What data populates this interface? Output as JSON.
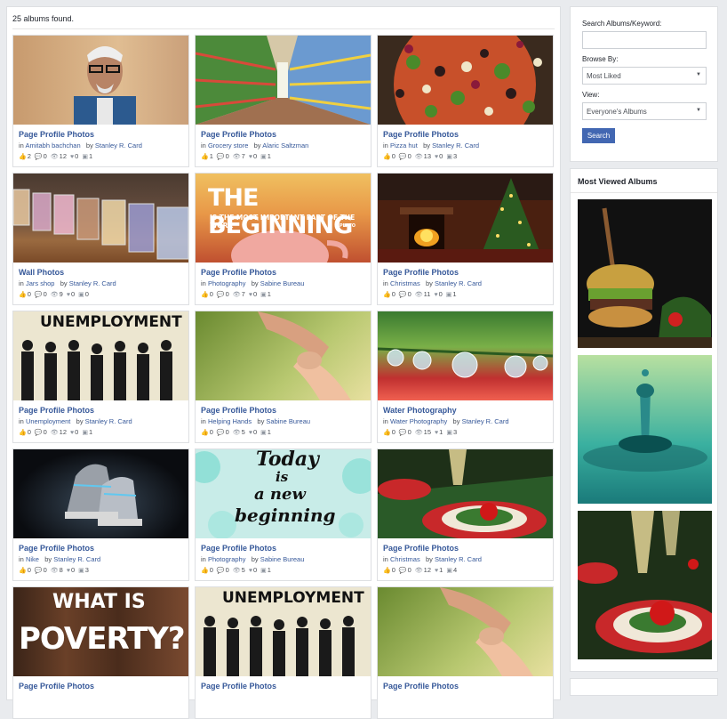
{
  "results": {
    "found_text": "25 albums found."
  },
  "albums": [
    {
      "title": "Page Profile Photos",
      "in_label": "in",
      "category": "Amitabh bachchan",
      "by_label": "by",
      "author": "Stanley R. Card",
      "likes": "2",
      "comments": "0",
      "views": "12",
      "favorites": "0",
      "photos": "1"
    },
    {
      "title": "Page Profile Photos",
      "in_label": "in",
      "category": "Grocery store",
      "by_label": "by",
      "author": "Alaric Saltzman",
      "likes": "1",
      "comments": "0",
      "views": "7",
      "favorites": "0",
      "photos": "1"
    },
    {
      "title": "Page Profile Photos",
      "in_label": "in",
      "category": "Pizza hut",
      "by_label": "by",
      "author": "Stanley R. Card",
      "likes": "0",
      "comments": "0",
      "views": "13",
      "favorites": "0",
      "photos": "3"
    },
    {
      "title": "Wall Photos",
      "in_label": "in",
      "category": "Jars shop",
      "by_label": "by",
      "author": "Stanley R. Card",
      "likes": "0",
      "comments": "0",
      "views": "9",
      "favorites": "0",
      "photos": "0"
    },
    {
      "title": "Page Profile Photos",
      "in_label": "in",
      "category": "Photography",
      "by_label": "by",
      "author": "Sabine Bureau",
      "likes": "0",
      "comments": "0",
      "views": "7",
      "favorites": "0",
      "photos": "1"
    },
    {
      "title": "Page Profile Photos",
      "in_label": "in",
      "category": "Christmas",
      "by_label": "by",
      "author": "Stanley R. Card",
      "likes": "0",
      "comments": "0",
      "views": "11",
      "favorites": "0",
      "photos": "1"
    },
    {
      "title": "Page Profile Photos",
      "in_label": "in",
      "category": "Unemployment",
      "by_label": "by",
      "author": "Stanley R. Card",
      "likes": "0",
      "comments": "0",
      "views": "12",
      "favorites": "0",
      "photos": "1"
    },
    {
      "title": "Page Profile Photos",
      "in_label": "in",
      "category": "Helping Hands",
      "by_label": "by",
      "author": "Sabine Bureau",
      "likes": "0",
      "comments": "0",
      "views": "5",
      "favorites": "0",
      "photos": "1"
    },
    {
      "title": "Water Photography",
      "in_label": "in",
      "category": "Water Photography",
      "by_label": "by",
      "author": "Stanley R. Card",
      "likes": "0",
      "comments": "0",
      "views": "15",
      "favorites": "1",
      "photos": "3"
    },
    {
      "title": "Page Profile Photos",
      "in_label": "in",
      "category": "Nike",
      "by_label": "by",
      "author": "Stanley R. Card",
      "likes": "0",
      "comments": "0",
      "views": "8",
      "favorites": "0",
      "photos": "3"
    },
    {
      "title": "Page Profile Photos",
      "in_label": "in",
      "category": "Photography",
      "by_label": "by",
      "author": "Sabine Bureau",
      "likes": "0",
      "comments": "0",
      "views": "5",
      "favorites": "0",
      "photos": "1"
    },
    {
      "title": "Page Profile Photos",
      "in_label": "in",
      "category": "Christmas",
      "by_label": "by",
      "author": "Stanley R. Card",
      "likes": "0",
      "comments": "0",
      "views": "12",
      "favorites": "1",
      "photos": "4"
    },
    {
      "title": "Page Profile Photos"
    },
    {
      "title": "Page Profile Photos"
    },
    {
      "title": "Page Profile Photos"
    }
  ],
  "image_text": {
    "beginning_big": "THE BEGINNING",
    "beginning_small": "IS THE MOST IMPORTANT PART OF THE WORK",
    "beginning_author": "PLATO",
    "unemployment": "UNEMPLOYMENT",
    "today_1": "Today",
    "today_2": "is",
    "today_3": "a new",
    "today_4": "beginning",
    "poverty_1": "WHAT IS",
    "poverty_2": "POVERTY?"
  },
  "sidebar": {
    "search_label": "Search Albums/Keyword:",
    "search_value": "",
    "browse_label": "Browse By:",
    "browse_value": "Most Liked",
    "view_label": "View:",
    "view_value": "Everyone's Albums",
    "search_button": "Search",
    "most_viewed_title": "Most Viewed Albums"
  },
  "icons": {
    "like": "thumbs-up-icon",
    "comment": "comment-icon",
    "view": "eye-icon",
    "favorite": "heart-icon",
    "photos": "photo-icon"
  },
  "colors": {
    "link": "#365899",
    "button": "#4267b2",
    "page_bg": "#e9ebee"
  }
}
